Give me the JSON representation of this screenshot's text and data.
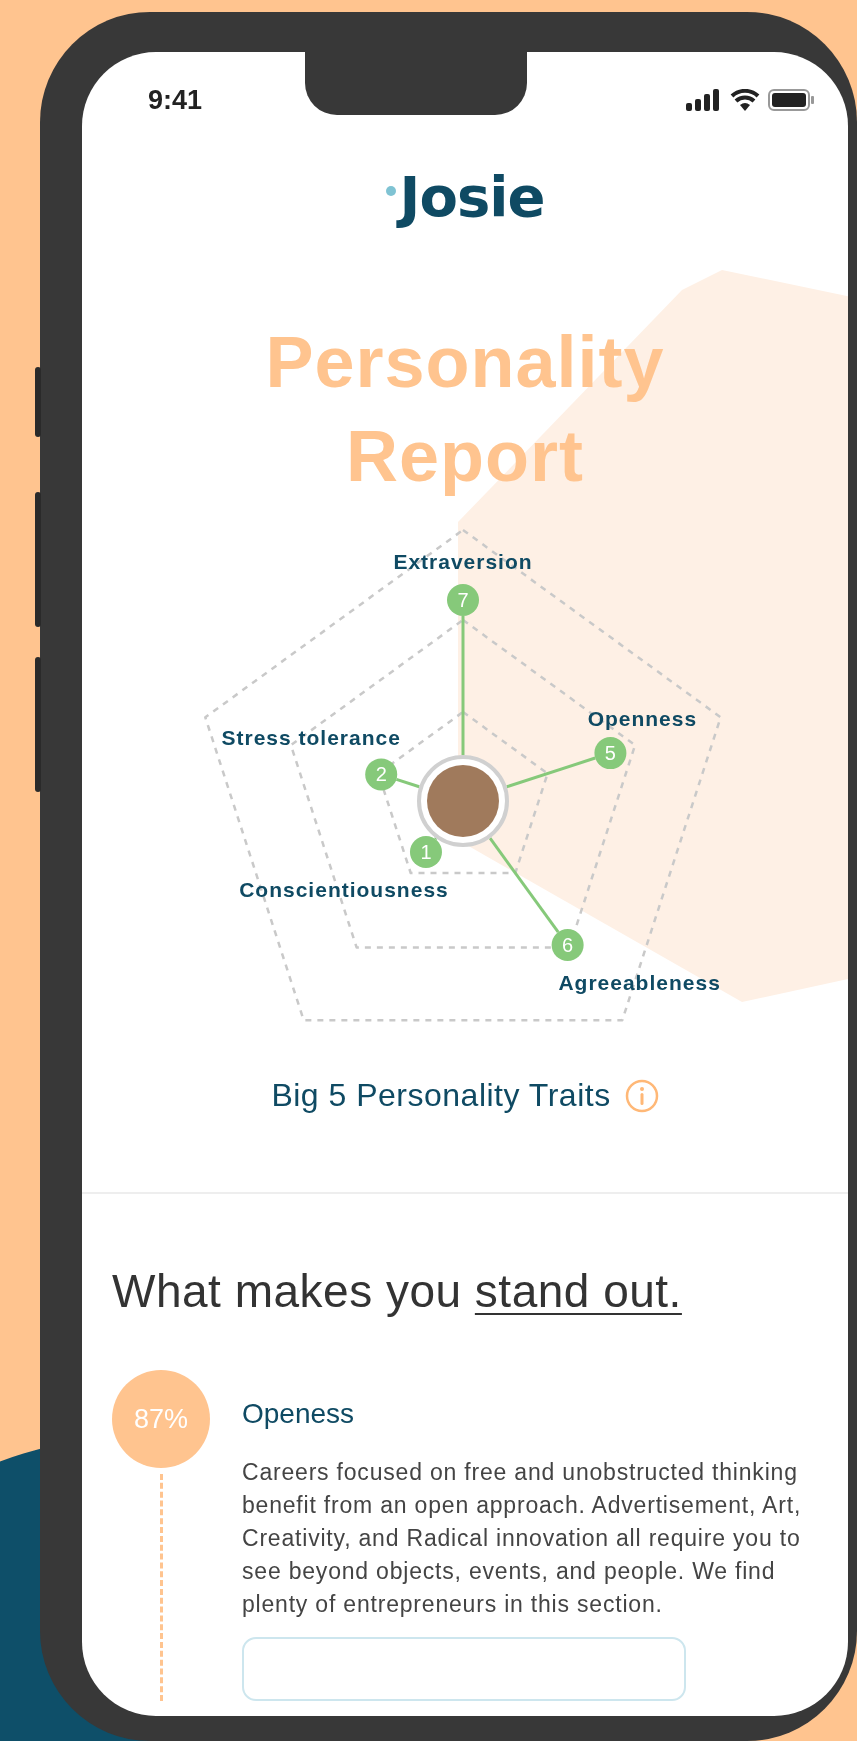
{
  "status_bar": {
    "time": "9:41"
  },
  "logo": "Josie",
  "title": "Personality Report",
  "chart": {
    "traits": [
      {
        "label": "Extraversion",
        "score": "7"
      },
      {
        "label": "Openness",
        "score": "5"
      },
      {
        "label": "Stress tolerance",
        "score": "2"
      },
      {
        "label": "Conscientiousness",
        "score": "1"
      },
      {
        "label": "Agreeableness",
        "score": "6"
      }
    ],
    "caption": "Big 5 Personality Traits"
  },
  "standout": {
    "heading_lead": "What makes you",
    "heading_underlined": "stand out.",
    "items": [
      {
        "percent": "87%",
        "title": "Openess",
        "description": "Careers focused on free and unobstructed thinking benefit from an open approach. Advertisement, Art, Creativity, and Radical innovation all require you to see beyond objects, events, and people. We find plenty of entrepreneurs in this section."
      }
    ]
  }
}
